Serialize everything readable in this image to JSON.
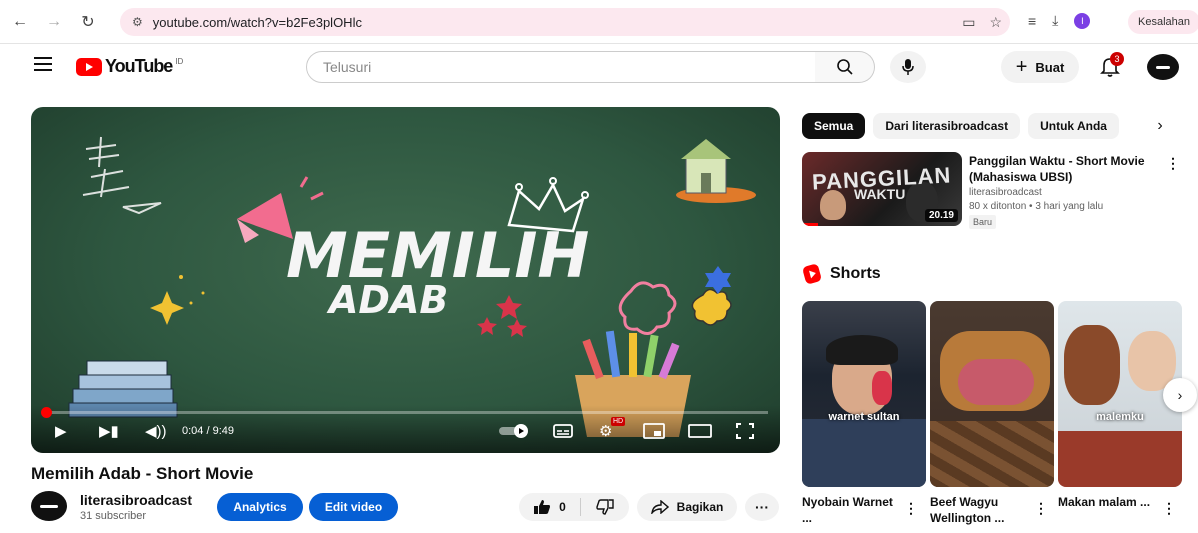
{
  "browser": {
    "url": "youtube.com/watch?v=b2Fe3plOHlc",
    "profile_initial": "I",
    "error_label": "Kesalahan"
  },
  "header": {
    "logo_text": "YouTube",
    "region": "ID",
    "search_placeholder": "Telusuri",
    "create_label": "Buat",
    "notifications_count": "3"
  },
  "player": {
    "art_title_line1": "MEMILIH",
    "art_title_line2": "ADAB",
    "time_display": "0:04 / 9:49",
    "progress_fraction": 0.007,
    "hd_badge": "HD"
  },
  "video": {
    "title": "Memilih Adab - Short Movie",
    "channel_name": "literasibroadcast",
    "subscribers": "31 subscriber",
    "analytics_label": "Analytics",
    "edit_label": "Edit video",
    "likes": "0",
    "share_label": "Bagikan",
    "more_label": "···"
  },
  "sidebar": {
    "chips": [
      {
        "label": "Semua",
        "active": true
      },
      {
        "label": "Dari literasibroadcast",
        "active": false
      },
      {
        "label": "Untuk Anda",
        "active": false
      }
    ],
    "recommended": {
      "thumb_text1": "PANGGILAN",
      "thumb_text2": "WAKTU",
      "duration": "20.19",
      "title": "Panggilan Waktu - Short Movie (Mahasiswa UBSI)",
      "channel": "literasibroadcast",
      "meta": "80 x ditonton • 3 hari yang lalu",
      "badge": "Baru"
    },
    "shorts_title": "Shorts",
    "shorts": [
      {
        "label": "warnet sultan",
        "title": "Nyobain Warnet ..."
      },
      {
        "label": "",
        "title": "Beef Wagyu Wellington ..."
      },
      {
        "label": "malemku",
        "title": "Makan malam ..."
      }
    ]
  }
}
